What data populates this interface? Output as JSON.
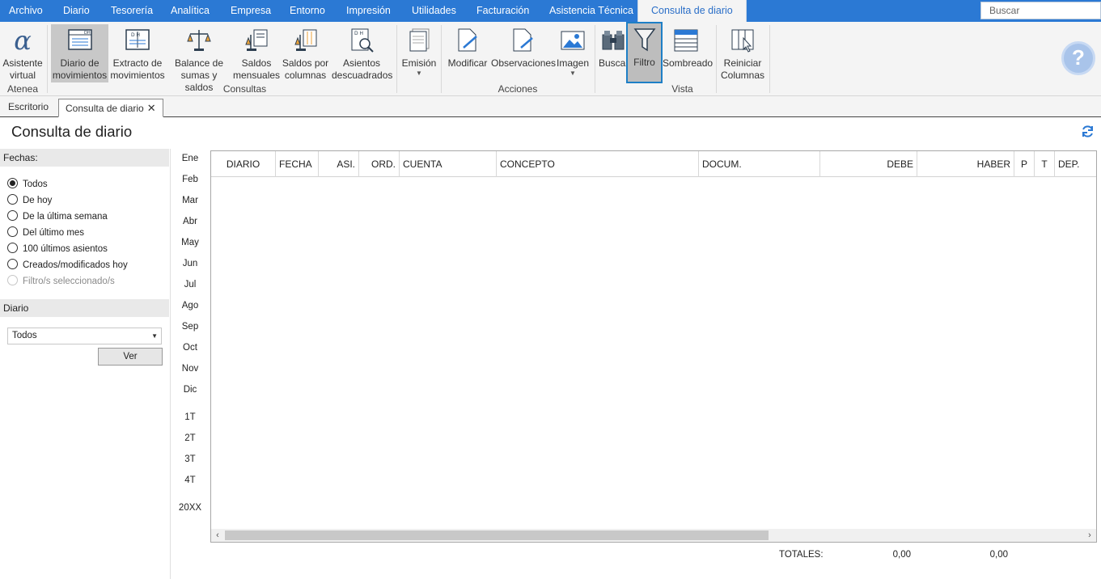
{
  "menu": {
    "items": [
      "Archivo",
      "Diario",
      "Tesorería",
      "Analítica",
      "Empresa",
      "Entorno",
      "Impresión",
      "Utilidades",
      "Facturación",
      "Asistencia Técnica"
    ],
    "active_tab": "Consulta de diario",
    "search_placeholder": "Buscar"
  },
  "ribbon": {
    "atenea": {
      "label": "Atenea",
      "asistente": [
        "Asistente",
        "virtual"
      ]
    },
    "consultas": {
      "label": "Consultas",
      "buttons": [
        [
          "Diario de",
          "movimientos"
        ],
        [
          "Extracto de",
          "movimientos"
        ],
        [
          "Balance de",
          "sumas y saldos"
        ],
        [
          "Saldos",
          "mensuales"
        ],
        [
          "Saldos por",
          "columnas"
        ],
        [
          "Asientos",
          "descuadrados"
        ]
      ],
      "emision": "Emisión"
    },
    "acciones": {
      "label": "Acciones",
      "modificar": "Modificar",
      "observaciones": "Observaciones",
      "imagen": "Imagen"
    },
    "vista": {
      "label": "Vista",
      "buscar": "Buscar",
      "filtro": "Filtro",
      "sombreado": "Sombreado",
      "reiniciar": [
        "Reiniciar",
        "Columnas"
      ]
    },
    "help_symbol": "?"
  },
  "tabs": {
    "escritorio": "Escritorio",
    "consulta": "Consulta de diario",
    "close": "✕"
  },
  "page": {
    "title": "Consulta de diario"
  },
  "filters": {
    "fechas_label": "Fechas:",
    "options": [
      {
        "label": "Todos",
        "checked": true
      },
      {
        "label": "De hoy",
        "checked": false
      },
      {
        "label": "De la última semana",
        "checked": false
      },
      {
        "label": "Del último mes",
        "checked": false
      },
      {
        "label": "100 últimos asientos",
        "checked": false
      },
      {
        "label": "Creados/modificados hoy",
        "checked": false
      },
      {
        "label": "Filtro/s seleccionado/s",
        "checked": false,
        "disabled": true
      }
    ],
    "diario_label": "Diario",
    "diario_value": "Todos",
    "ver_button": "Ver"
  },
  "periods": {
    "months": [
      "Ene",
      "Feb",
      "Mar",
      "Abr",
      "May",
      "Jun",
      "Jul",
      "Ago",
      "Sep",
      "Oct",
      "Nov",
      "Dic"
    ],
    "quarters": [
      "1T",
      "2T",
      "3T",
      "4T"
    ],
    "year": "20XX"
  },
  "grid": {
    "columns": [
      "DIARIO",
      "FECHA",
      "ASI.",
      "ORD.",
      "CUENTA",
      "CONCEPTO",
      "DOCUM.",
      "DEBE",
      "HABER",
      "P",
      "T",
      "DEP."
    ]
  },
  "totals": {
    "label": "TOTALES:",
    "debe": "0,00",
    "haber": "0,00"
  },
  "colors": {
    "menu_bar": "#2b79d4",
    "accent": "#1e7fc6"
  }
}
